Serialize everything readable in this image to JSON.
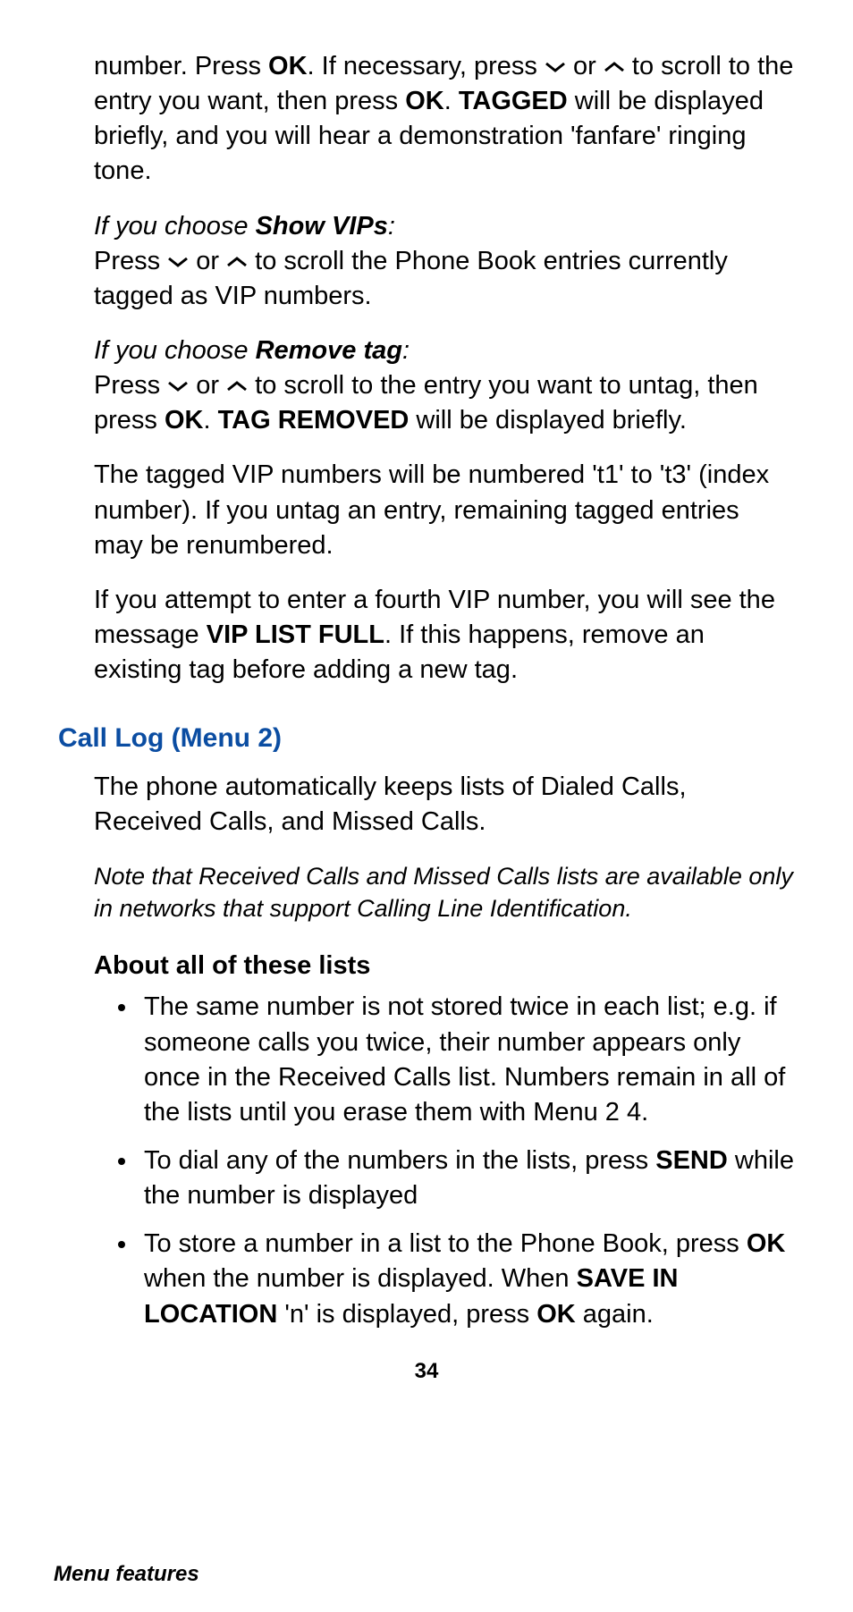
{
  "p1": {
    "t1": "number. Press ",
    "ok1": "OK",
    "t2": ". If necessary, press ",
    "t3": " or ",
    "t4": " to scroll to the entry you want, then press ",
    "ok2": "OK",
    "t5": ". ",
    "tagged": "TAGGED",
    "t6": " will be displayed briefly, and you will hear a demonstration 'fanfare' ringing tone."
  },
  "p2": {
    "lead_it": "If you choose ",
    "lead_b": "Show VIPs",
    "lead_end": ":",
    "t1": "Press ",
    "t2": " or ",
    "t3": " to scroll the Phone Book entries currently tagged as VIP numbers."
  },
  "p3": {
    "lead_it": "If you choose ",
    "lead_b": "Remove tag",
    "lead_end": ":",
    "t1": "Press ",
    "t2": " or ",
    "t3": " to scroll to the entry you want to untag, then press ",
    "ok": "OK",
    "t4": ". ",
    "tr": "TAG REMOVED",
    "t5": " will be displayed briefly."
  },
  "p4": "The tagged VIP numbers will be numbered 't1' to 't3' (index number). If you untag an entry, remaining tagged entries may be renumbered.",
  "p5": {
    "t1": "If you attempt to enter a fourth VIP number, you will see the message ",
    "vlf": "VIP LIST FULL",
    "t2": ". If this happens, remove an existing tag before adding a new tag."
  },
  "heading": "Call Log (Menu 2)",
  "p6": "The phone automatically keeps lists of Dialed Calls, Received Calls, and Missed Calls.",
  "note": "Note that Received Calls and Missed Calls lists are available only in networks that support Calling Line Identification.",
  "subhead": "About all of these lists",
  "bullets": {
    "b1": "The same number is not stored twice in each list; e.g. if someone calls you twice, their number appears only once in the Received Calls list. Numbers remain in all of the lists until you erase them with Menu 2 4.",
    "b2": {
      "t1": "To dial any of the numbers in the lists, press ",
      "send": "SEND",
      "t2": " while the number is displayed"
    },
    "b3": {
      "t1": "To store a number in a list to the Phone Book, press ",
      "ok1": "OK",
      "t2": " when the number is displayed. When ",
      "sil": "SAVE IN LOCATION",
      "t3": " 'n' is displayed, press ",
      "ok2": "OK",
      "t4": " again."
    }
  },
  "pagenum": "34",
  "footer": "Menu features"
}
